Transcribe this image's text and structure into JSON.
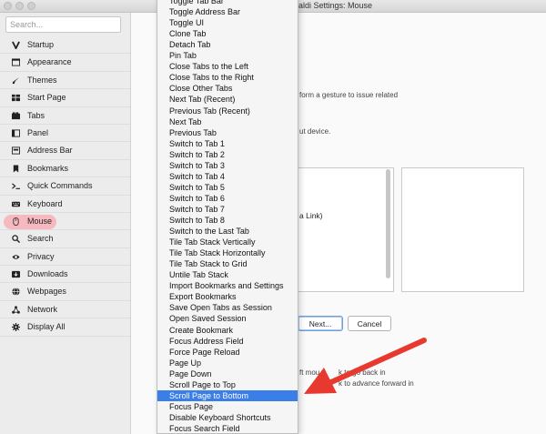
{
  "window": {
    "title": "aldi Settings: Mouse"
  },
  "sidebar": {
    "search_placeholder": "Search...",
    "items": [
      {
        "label": "Startup",
        "icon": "v-logo-icon"
      },
      {
        "label": "Appearance",
        "icon": "window-icon"
      },
      {
        "label": "Themes",
        "icon": "brush-icon"
      },
      {
        "label": "Start Page",
        "icon": "grid-icon"
      },
      {
        "label": "Tabs",
        "icon": "tabs-icon"
      },
      {
        "label": "Panel",
        "icon": "panel-icon"
      },
      {
        "label": "Address Bar",
        "icon": "address-bar-icon"
      },
      {
        "label": "Bookmarks",
        "icon": "bookmark-icon"
      },
      {
        "label": "Quick Commands",
        "icon": "command-icon"
      },
      {
        "label": "Keyboard",
        "icon": "keyboard-icon"
      },
      {
        "label": "Mouse",
        "icon": "mouse-icon",
        "active": true
      },
      {
        "label": "Search",
        "icon": "search-icon"
      },
      {
        "label": "Privacy",
        "icon": "eye-icon"
      },
      {
        "label": "Downloads",
        "icon": "download-icon"
      },
      {
        "label": "Webpages",
        "icon": "globe-icon"
      },
      {
        "label": "Network",
        "icon": "network-icon"
      },
      {
        "label": "Display All",
        "icon": "gear-icon"
      }
    ]
  },
  "content": {
    "text_gesture": "form a gesture to issue related",
    "text_device": "ut device.",
    "text_link": "a Link)",
    "next_label": "Next...",
    "cancel_label": "Cancel",
    "text_back": "ft mou",
    "text_back2": "k to go back in",
    "text_forward": "k to advance forward in"
  },
  "menu": {
    "selected": "Scroll Page to Bottom",
    "items": [
      "Toggle Tab Bar",
      "Toggle Address Bar",
      "Toggle UI",
      "Clone Tab",
      "Detach Tab",
      "Pin Tab",
      "Close Tabs to the Left",
      "Close Tabs to the Right",
      "Close Other Tabs",
      "Next Tab (Recent)",
      "Previous Tab (Recent)",
      "Next Tab",
      "Previous Tab",
      "Switch to Tab 1",
      "Switch to Tab 2",
      "Switch to Tab 3",
      "Switch to Tab 4",
      "Switch to Tab 5",
      "Switch to Tab 6",
      "Switch to Tab 7",
      "Switch to Tab 8",
      "Switch to the Last Tab",
      "Tile Tab Stack Vertically",
      "Tile Tab Stack Horizontally",
      "Tile Tab Stack to Grid",
      "Untile Tab Stack",
      "Import Bookmarks and Settings",
      "Export Bookmarks",
      "Save Open Tabs as Session",
      "Open Saved Session",
      "Create Bookmark",
      "Focus Address Field",
      "Force Page Reload",
      "Page Up",
      "Page Down",
      "Scroll Page to Top",
      "Scroll Page to Bottom",
      "Focus Page",
      "Disable Keyboard Shortcuts",
      "Focus Search Field"
    ]
  },
  "colors": {
    "highlight": "#3a7ee8",
    "annotation": "#e8392f",
    "active_pill": "#f7b9c0"
  }
}
